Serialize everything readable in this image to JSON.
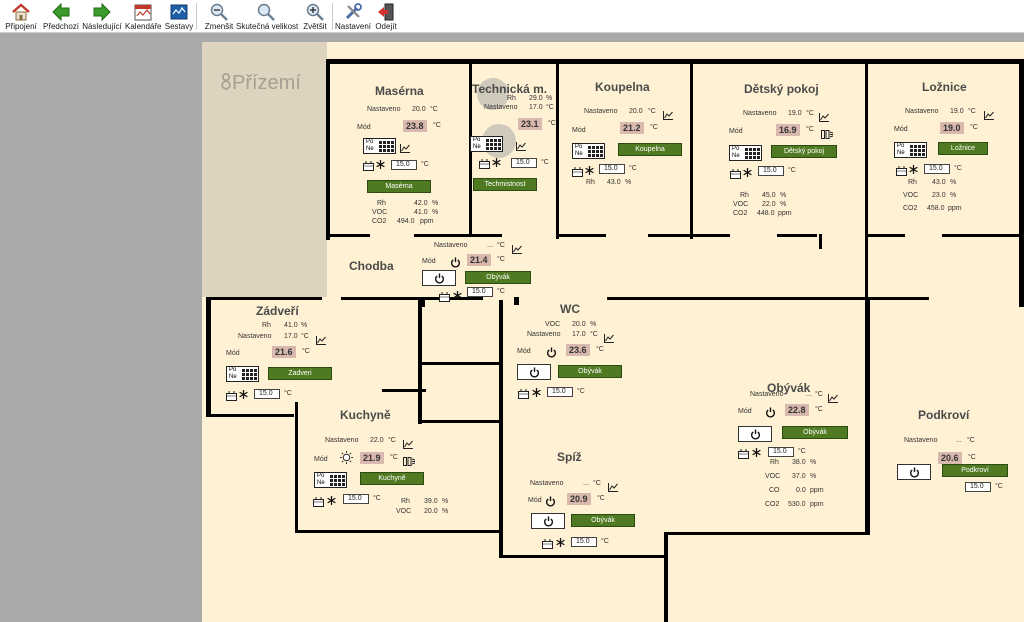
{
  "toolbar": {
    "items": [
      {
        "label": "Připojení",
        "icon": "home-icon"
      },
      {
        "label": "Předchozí",
        "icon": "arrow-left-icon"
      },
      {
        "label": "Následující",
        "icon": "arrow-right-icon"
      },
      {
        "label": "Kalendáře",
        "icon": "calendar-icon"
      },
      {
        "label": "Sestavy",
        "icon": "report-icon"
      },
      {
        "label": "Zmenšit",
        "icon": "zoom-out-icon"
      },
      {
        "label": "Skutečná velikost",
        "icon": "zoom-reset-icon"
      },
      {
        "label": "Zvětšit",
        "icon": "zoom-in-icon"
      },
      {
        "label": "Nastavení",
        "icon": "tools-icon"
      },
      {
        "label": "Odejít",
        "icon": "exit-icon"
      }
    ]
  },
  "floor": {
    "title": "Přízemí",
    "icon": "floor-icon"
  },
  "labels": {
    "set": "Nastaveno",
    "mode": "Mód",
    "rh": "Rh",
    "voc": "VOC",
    "co2": "CO2",
    "co": "CO",
    "unit_c": "°C",
    "unit_pct": "%",
    "unit_ppm": "ppm",
    "pp": "Po",
    "ne": "Ne"
  },
  "colors": {
    "floor_bg": "#fff1d3",
    "stair_bg": "#ddd3bf",
    "wall": "#000000",
    "button_green": "#4f7a22",
    "value_bg": "#d9b9ae"
  },
  "rooms": {
    "maserna": {
      "name": "Masérna",
      "set": "20.0",
      "temp": "23.8",
      "prog": "15.0",
      "button": "Masérna",
      "rh": "42.0",
      "voc": "41.0",
      "co2": "494.0"
    },
    "technicka": {
      "name": "Technická m.",
      "rh": "29.0",
      "set": "17.0",
      "temp": "23.1",
      "prog": "15.0",
      "button": "Techmistnost"
    },
    "koupelna": {
      "name": "Koupelna",
      "set": "20.0",
      "temp": "21.2",
      "prog": "15.0",
      "button": "Koupelna",
      "rh": "43.0"
    },
    "detsky": {
      "name": "Dětský pokoj",
      "set": "19.0",
      "temp": "16.9",
      "prog": "15.0",
      "button": "Dětský pokoj",
      "rh": "45.0",
      "voc": "22.0",
      "co2": "448.0"
    },
    "loznice": {
      "name": "Ložnice",
      "set": "19.0",
      "temp": "19.0",
      "prog": "15.0",
      "button": "Ložnice",
      "rh": "43.0",
      "voc": "23.0",
      "co2": "458.0"
    },
    "chodba": {
      "name": "Chodba",
      "set": "...",
      "temp": "21.4",
      "prog": "15.0",
      "button": "Obývák"
    },
    "zadveri": {
      "name": "Zádveří",
      "rh": "41.0",
      "set": "17.0",
      "temp": "21.6",
      "prog": "15.0",
      "button": "Zadveri"
    },
    "wc": {
      "name": "WC",
      "voc": "20.0",
      "set": "17.0",
      "temp": "23.6",
      "prog": "15.0",
      "button": "Obývák"
    },
    "kuchyne": {
      "name": "Kuchyně",
      "set": "22.0",
      "temp": "21.9",
      "prog": "15.0",
      "button": "Kuchyně",
      "rh": "39.0",
      "voc": "20.0"
    },
    "spiz": {
      "name": "Spíž",
      "set": "...",
      "temp": "20.9",
      "prog": "15.0",
      "button": "Obývák"
    },
    "obyvak": {
      "name": "Obývák",
      "set": "...",
      "temp": "22.8",
      "prog": "15.0",
      "button": "Obývák",
      "rh": "38.0",
      "voc": "37.0",
      "co": "0.0",
      "co2": "530.0"
    },
    "podkrovi": {
      "name": "Podkroví",
      "set": "...",
      "temp": "20.6",
      "prog": "15.0",
      "button": "Podkroví"
    }
  }
}
